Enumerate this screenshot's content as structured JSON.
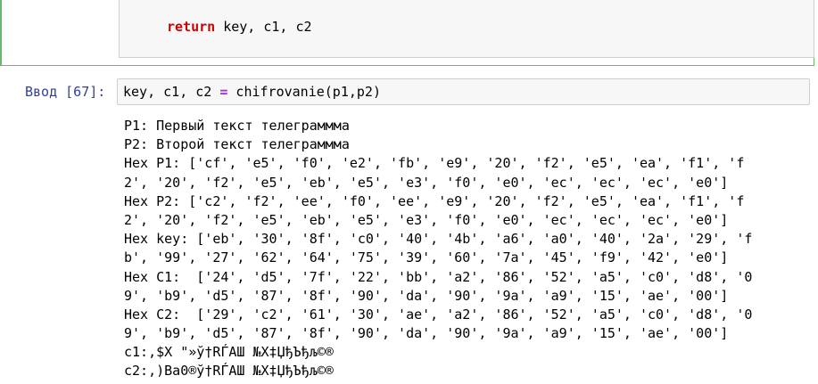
{
  "previous_cell": {
    "keyword": "return",
    "rest": " key, c1, c2"
  },
  "current_cell": {
    "prompt": "Ввод [67]:",
    "code_prefix": "key, c1, c2 ",
    "code_operator": "=",
    "code_suffix": " chifrovanie(p1,p2)"
  },
  "output": {
    "lines": [
      "P1: Первый текст телеграммма",
      "P2: Второй текст телеграммма",
      "Hex P1: ['cf', 'e5', 'f0', 'e2', 'fb', 'e9', '20', 'f2', 'e5', 'ea', 'f1', 'f",
      "2', '20', 'f2', 'e5', 'eb', 'e5', 'e3', 'f0', 'e0', 'ec', 'ec', 'ec', 'e0']",
      "Hex P2: ['c2', 'f2', 'ee', 'f0', 'ee', 'e9', '20', 'f2', 'e5', 'ea', 'f1', 'f",
      "2', '20', 'f2', 'e5', 'eb', 'e5', 'e3', 'f0', 'e0', 'ec', 'ec', 'ec', 'e0']",
      "Hex key: ['eb', '30', '8f', 'c0', '40', '4b', 'a6', 'a0', '40', '2a', '29', 'f",
      "b', '99', '27', '62', '64', '75', '39', '60', '7a', '45', 'f9', '42', 'e0']",
      "Hex C1:  ['24', 'd5', '7f', '22', 'bb', 'a2', '86', '52', 'a5', 'c0', 'd8', '0",
      "9', 'b9', 'd5', '87', '8f', '90', 'da', '90', '9a', 'a9', '15', 'ae', '00']",
      "Hex C2:  ['29', 'c2', '61', '30', 'ae', 'a2', '86', '52', 'a5', 'c0', 'd8', '0",
      "9', 'b9', 'd5', '87', '8f', '90', 'da', '90', '9a', 'a9', '15', 'ae', '00']",
      "c1:,$X \"»ў†RЃАШ №Х‡ЏђЪђљ©\u0015®",
      "c2:,)Ba0®ў†RЃАШ №Х‡ЏђЪђљ©\u0015®"
    ]
  },
  "colors": {
    "prompt": "#303f9f",
    "selected_border": "#66bb6a",
    "keyword_return": "#d00000",
    "operator": "#aa22ff",
    "input_bg": "#f7f7f7"
  }
}
